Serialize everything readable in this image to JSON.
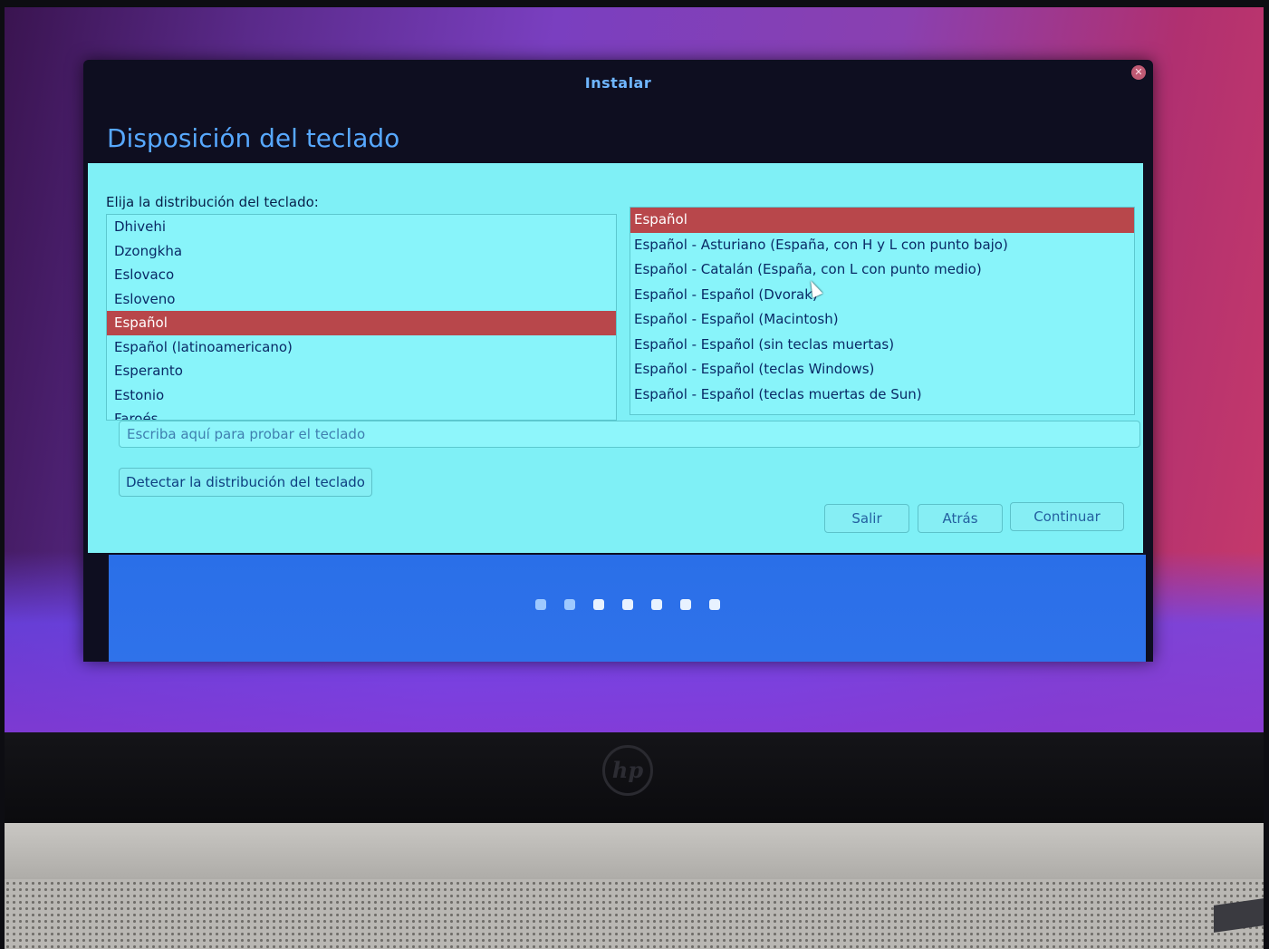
{
  "window": {
    "title": "Instalar",
    "close_icon": "close-icon"
  },
  "page": {
    "title": "Disposición del teclado",
    "prompt": "Elija la distribución del teclado:"
  },
  "layouts": {
    "items": [
      {
        "label": "Dhivehi",
        "selected": false
      },
      {
        "label": "Dzongkha",
        "selected": false
      },
      {
        "label": "Eslovaco",
        "selected": false
      },
      {
        "label": "Esloveno",
        "selected": false
      },
      {
        "label": "Español",
        "selected": true
      },
      {
        "label": "Español (latinoamericano)",
        "selected": false
      },
      {
        "label": "Esperanto",
        "selected": false
      },
      {
        "label": "Estonio",
        "selected": false
      },
      {
        "label": "Faroés",
        "selected": false
      }
    ]
  },
  "variants": {
    "items": [
      {
        "label": "Español",
        "selected": true
      },
      {
        "label": "Español - Asturiano (España, con H y L con punto bajo)",
        "selected": false
      },
      {
        "label": "Español - Catalán (España, con L con punto medio)",
        "selected": false
      },
      {
        "label": "Español - Español (Dvorak)",
        "selected": false
      },
      {
        "label": "Español - Español (Macintosh)",
        "selected": false
      },
      {
        "label": "Español - Español (sin teclas muertas)",
        "selected": false
      },
      {
        "label": "Español - Español (teclas Windows)",
        "selected": false
      },
      {
        "label": "Español - Español (teclas muertas de Sun)",
        "selected": false
      }
    ]
  },
  "test_input": {
    "placeholder": "Escriba aquí para probar el teclado",
    "value": ""
  },
  "buttons": {
    "detect": "Detectar la distribución del teclado",
    "quit": "Salir",
    "back": "Atrás",
    "continue": "Continuar"
  },
  "progress": {
    "total_steps": 7,
    "current_step": 2
  },
  "device": {
    "logo_text": "hp"
  },
  "colors": {
    "selection": "#b8474b",
    "content_bg": "#7ff0f6",
    "title_blue": "#57a8ff",
    "footer_blue": "#2a6fe8"
  }
}
